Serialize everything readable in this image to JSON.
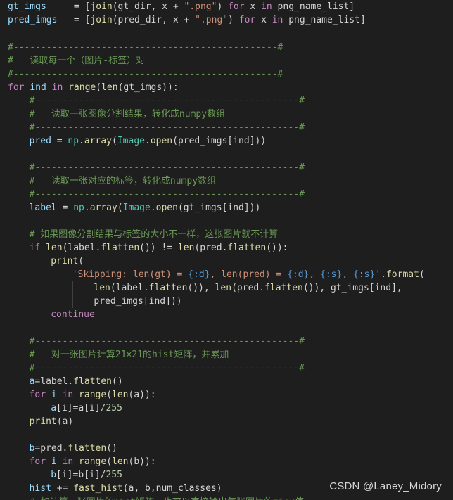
{
  "colors": {
    "background": "#1e1e1e",
    "keyword": "#c586c0",
    "function": "#dcdcaa",
    "class": "#4ec9b0",
    "variable": "#9cdcfe",
    "string": "#ce9178",
    "format": "#569cd6",
    "comment": "#6a9955",
    "number": "#b5cea8",
    "text": "#d4d4d4"
  },
  "watermark": "CSDN @Laney_Midory",
  "cutoff_text": "# 如计算一张图片的hist矩阵，也可以直接输出每张图片的miou值",
  "lines": [
    {
      "indent": 0,
      "sep": false,
      "tokens": [
        [
          "var",
          "gt_imgs"
        ],
        [
          "op",
          "     = ["
        ],
        [
          "fn",
          "join"
        ],
        [
          "op",
          "(gt_dir, x + "
        ],
        [
          "str",
          "\".png\""
        ],
        [
          "op",
          ") "
        ],
        [
          "kw",
          "for"
        ],
        [
          "op",
          " x "
        ],
        [
          "kw",
          "in"
        ],
        [
          "op",
          " png_name_list]"
        ]
      ]
    },
    {
      "indent": 0,
      "sep": true,
      "tokens": [
        [
          "var",
          "pred_imgs"
        ],
        [
          "op",
          "   = ["
        ],
        [
          "fn",
          "join"
        ],
        [
          "op",
          "(pred_dir, x + "
        ],
        [
          "str",
          "\".png\""
        ],
        [
          "op",
          ") "
        ],
        [
          "kw",
          "for"
        ],
        [
          "op",
          " x "
        ],
        [
          "kw",
          "in"
        ],
        [
          "op",
          " png_name_list]"
        ]
      ]
    },
    {
      "indent": 0,
      "sep": false,
      "tokens": []
    },
    {
      "indent": 0,
      "sep": false,
      "tokens": [
        [
          "cm",
          "#------------------------------------------------#"
        ]
      ]
    },
    {
      "indent": 0,
      "sep": false,
      "tokens": [
        [
          "cm",
          "#   读取每一个（图片-标签）对"
        ]
      ]
    },
    {
      "indent": 0,
      "sep": false,
      "tokens": [
        [
          "cm",
          "#------------------------------------------------#"
        ]
      ]
    },
    {
      "indent": 0,
      "sep": false,
      "tokens": [
        [
          "kw",
          "for"
        ],
        [
          "op",
          " "
        ],
        [
          "var",
          "ind"
        ],
        [
          "op",
          " "
        ],
        [
          "kw",
          "in"
        ],
        [
          "op",
          " "
        ],
        [
          "fn",
          "range"
        ],
        [
          "op",
          "("
        ],
        [
          "fn",
          "len"
        ],
        [
          "op",
          "(gt_imgs)):"
        ]
      ]
    },
    {
      "indent": 1,
      "sep": false,
      "tokens": [
        [
          "cm",
          "#------------------------------------------------#"
        ]
      ]
    },
    {
      "indent": 1,
      "sep": false,
      "tokens": [
        [
          "cm",
          "#   读取一张图像分割结果，转化成numpy数组"
        ]
      ]
    },
    {
      "indent": 1,
      "sep": false,
      "tokens": [
        [
          "cm",
          "#------------------------------------------------#"
        ]
      ]
    },
    {
      "indent": 1,
      "sep": false,
      "tokens": [
        [
          "var",
          "pred"
        ],
        [
          "op",
          " = "
        ],
        [
          "cls",
          "np"
        ],
        [
          "op",
          "."
        ],
        [
          "fn",
          "array"
        ],
        [
          "op",
          "("
        ],
        [
          "cls",
          "Image"
        ],
        [
          "op",
          "."
        ],
        [
          "fn",
          "open"
        ],
        [
          "op",
          "(pred_imgs[ind]))"
        ]
      ]
    },
    {
      "indent": 1,
      "sep": false,
      "tokens": []
    },
    {
      "indent": 1,
      "sep": false,
      "tokens": [
        [
          "cm",
          "#------------------------------------------------#"
        ]
      ]
    },
    {
      "indent": 1,
      "sep": false,
      "tokens": [
        [
          "cm",
          "#   读取一张对应的标签，转化成numpy数组"
        ]
      ]
    },
    {
      "indent": 1,
      "sep": false,
      "tokens": [
        [
          "cm",
          "#------------------------------------------------#"
        ]
      ]
    },
    {
      "indent": 1,
      "sep": false,
      "tokens": [
        [
          "var",
          "label"
        ],
        [
          "op",
          " = "
        ],
        [
          "cls",
          "np"
        ],
        [
          "op",
          "."
        ],
        [
          "fn",
          "array"
        ],
        [
          "op",
          "("
        ],
        [
          "cls",
          "Image"
        ],
        [
          "op",
          "."
        ],
        [
          "fn",
          "open"
        ],
        [
          "op",
          "(gt_imgs[ind]))"
        ]
      ]
    },
    {
      "indent": 1,
      "sep": false,
      "tokens": []
    },
    {
      "indent": 1,
      "sep": false,
      "tokens": [
        [
          "cm",
          "# 如果图像分割结果与标签的大小不一样，这张图片就不计算"
        ]
      ]
    },
    {
      "indent": 1,
      "sep": false,
      "tokens": [
        [
          "kw",
          "if"
        ],
        [
          "op",
          " "
        ],
        [
          "fn",
          "len"
        ],
        [
          "op",
          "(label."
        ],
        [
          "fn",
          "flatten"
        ],
        [
          "op",
          "()) != "
        ],
        [
          "fn",
          "len"
        ],
        [
          "op",
          "(pred."
        ],
        [
          "fn",
          "flatten"
        ],
        [
          "op",
          "()):"
        ]
      ]
    },
    {
      "indent": 2,
      "sep": false,
      "tokens": [
        [
          "fn",
          "print"
        ],
        [
          "op",
          "("
        ]
      ]
    },
    {
      "indent": 3,
      "sep": false,
      "tokens": [
        [
          "str",
          "'Skipping: len(gt) = "
        ],
        [
          "fmt",
          "{:d}"
        ],
        [
          "str",
          ", len(pred) = "
        ],
        [
          "fmt",
          "{:d}"
        ],
        [
          "str",
          ", "
        ],
        [
          "fmt",
          "{:s}"
        ],
        [
          "str",
          ", "
        ],
        [
          "fmt",
          "{:s}"
        ],
        [
          "str",
          "'"
        ],
        [
          "op",
          "."
        ],
        [
          "fn",
          "format"
        ],
        [
          "op",
          "("
        ]
      ]
    },
    {
      "indent": 4,
      "sep": false,
      "tokens": [
        [
          "fn",
          "len"
        ],
        [
          "op",
          "(label."
        ],
        [
          "fn",
          "flatten"
        ],
        [
          "op",
          "()), "
        ],
        [
          "fn",
          "len"
        ],
        [
          "op",
          "(pred."
        ],
        [
          "fn",
          "flatten"
        ],
        [
          "op",
          "()), gt_imgs[ind],"
        ]
      ]
    },
    {
      "indent": 4,
      "sep": false,
      "tokens": [
        [
          "op",
          "pred_imgs[ind]))"
        ]
      ]
    },
    {
      "indent": 2,
      "sep": false,
      "tokens": [
        [
          "kw",
          "continue"
        ]
      ]
    },
    {
      "indent": 1,
      "sep": false,
      "tokens": []
    },
    {
      "indent": 1,
      "sep": false,
      "tokens": [
        [
          "cm",
          "#------------------------------------------------#"
        ]
      ]
    },
    {
      "indent": 1,
      "sep": false,
      "tokens": [
        [
          "cm",
          "#   对一张图片计算21×21的hist矩阵，并累加"
        ]
      ]
    },
    {
      "indent": 1,
      "sep": false,
      "tokens": [
        [
          "cm",
          "#------------------------------------------------#"
        ]
      ]
    },
    {
      "indent": 1,
      "sep": false,
      "tokens": [
        [
          "var",
          "a"
        ],
        [
          "op",
          "=label."
        ],
        [
          "fn",
          "flatten"
        ],
        [
          "op",
          "()"
        ]
      ]
    },
    {
      "indent": 1,
      "sep": false,
      "tokens": [
        [
          "kw",
          "for"
        ],
        [
          "op",
          " "
        ],
        [
          "var",
          "i"
        ],
        [
          "op",
          " "
        ],
        [
          "kw",
          "in"
        ],
        [
          "op",
          " "
        ],
        [
          "fn",
          "range"
        ],
        [
          "op",
          "("
        ],
        [
          "fn",
          "len"
        ],
        [
          "op",
          "(a)):"
        ]
      ]
    },
    {
      "indent": 2,
      "sep": false,
      "tokens": [
        [
          "var",
          "a"
        ],
        [
          "op",
          "[i]=a[i]/"
        ],
        [
          "num",
          "255"
        ]
      ]
    },
    {
      "indent": 1,
      "sep": false,
      "tokens": [
        [
          "fn",
          "print"
        ],
        [
          "op",
          "(a)"
        ]
      ]
    },
    {
      "indent": 1,
      "sep": false,
      "tokens": []
    },
    {
      "indent": 1,
      "sep": false,
      "tokens": [
        [
          "var",
          "b"
        ],
        [
          "op",
          "=pred."
        ],
        [
          "fn",
          "flatten"
        ],
        [
          "op",
          "()"
        ]
      ]
    },
    {
      "indent": 1,
      "sep": false,
      "tokens": [
        [
          "kw",
          "for"
        ],
        [
          "op",
          " "
        ],
        [
          "var",
          "i"
        ],
        [
          "op",
          " "
        ],
        [
          "kw",
          "in"
        ],
        [
          "op",
          " "
        ],
        [
          "fn",
          "range"
        ],
        [
          "op",
          "("
        ],
        [
          "fn",
          "len"
        ],
        [
          "op",
          "(b)):"
        ]
      ]
    },
    {
      "indent": 2,
      "sep": false,
      "tokens": [
        [
          "var",
          "b"
        ],
        [
          "op",
          "[i]=b[i]/"
        ],
        [
          "num",
          "255"
        ]
      ]
    },
    {
      "indent": 1,
      "sep": false,
      "tokens": [
        [
          "var",
          "hist"
        ],
        [
          "op",
          " += "
        ],
        [
          "fn",
          "fast_hist"
        ],
        [
          "op",
          "(a, b,num_classes)"
        ]
      ]
    }
  ]
}
